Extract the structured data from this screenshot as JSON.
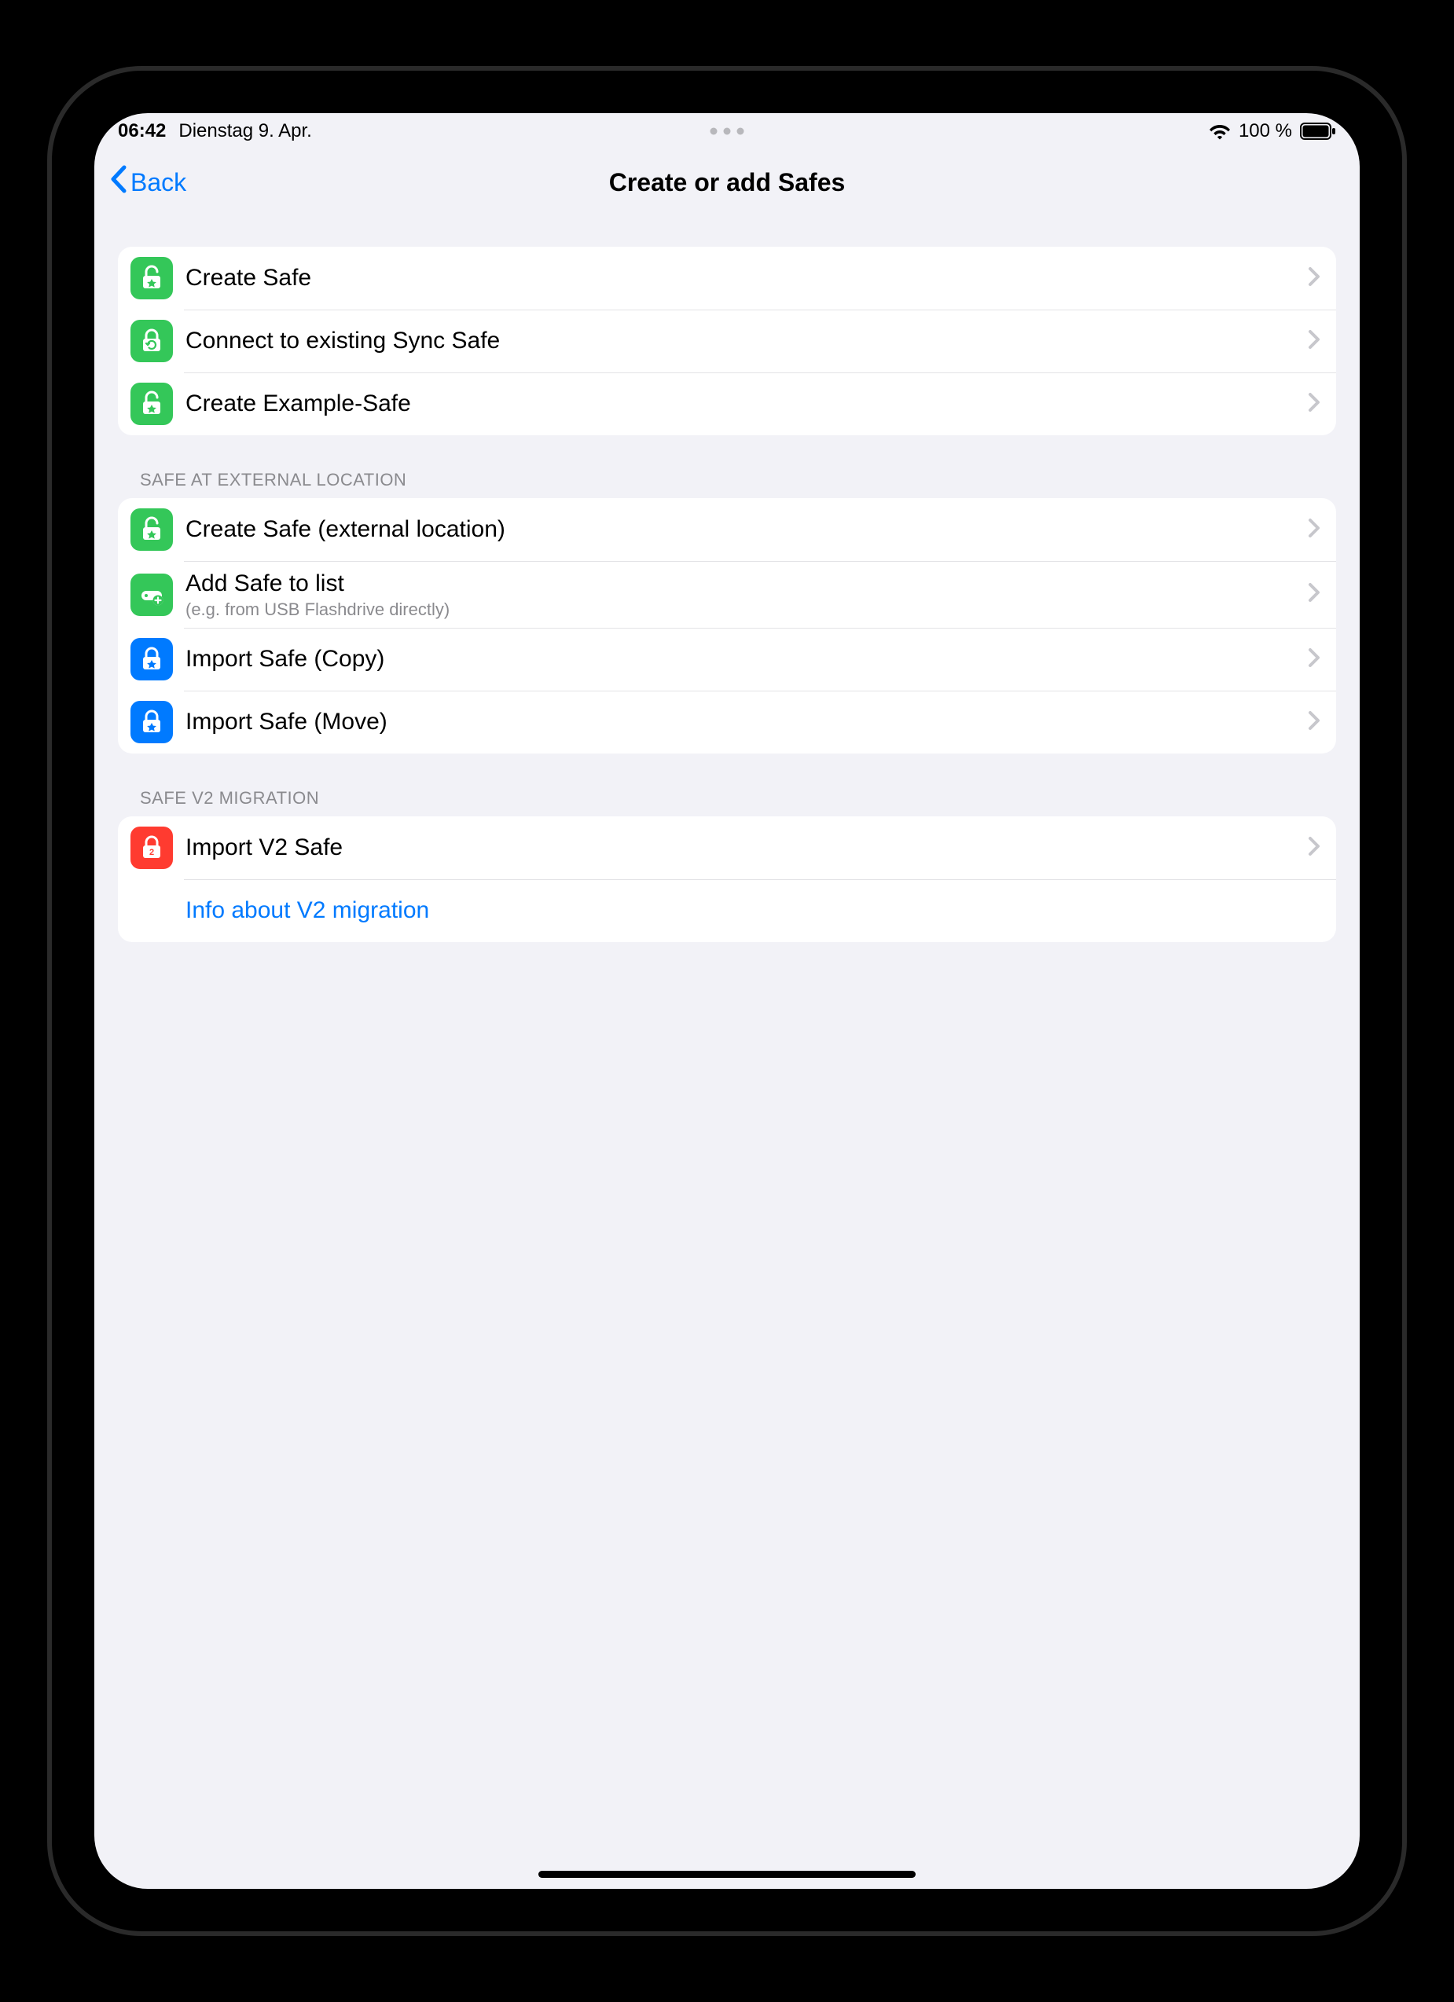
{
  "statusbar": {
    "time": "06:42",
    "date": "Dienstag 9. Apr.",
    "battery_pct": "100 %"
  },
  "nav": {
    "back_label": "Back",
    "title": "Create or add Safes"
  },
  "sections": {
    "main": {
      "rows": [
        {
          "label": "Create Safe"
        },
        {
          "label": "Connect to existing Sync Safe"
        },
        {
          "label": "Create Example-Safe"
        }
      ]
    },
    "external": {
      "header": "SAFE AT EXTERNAL LOCATION",
      "rows": [
        {
          "label": "Create Safe (external location)"
        },
        {
          "label": "Add Safe to list",
          "sublabel": "(e.g. from USB Flashdrive directly)"
        },
        {
          "label": "Import Safe (Copy)"
        },
        {
          "label": "Import Safe (Move)"
        }
      ]
    },
    "migration": {
      "header": "SAFE V2 MIGRATION",
      "rows": [
        {
          "label": "Import V2 Safe"
        },
        {
          "label": "Info about V2 migration"
        }
      ]
    }
  }
}
